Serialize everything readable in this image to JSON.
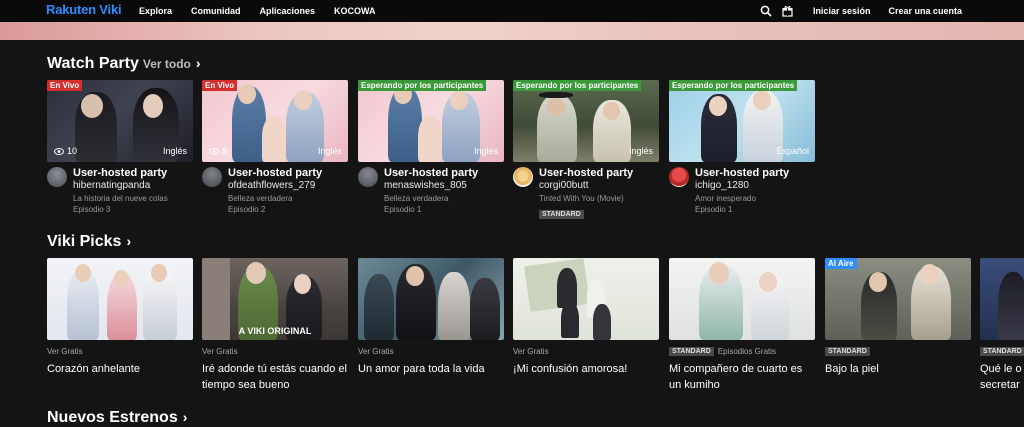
{
  "nav": {
    "logo": "Rakuten Viki",
    "links": [
      "Explora",
      "Comunidad",
      "Aplicaciones",
      "KOCOWA"
    ],
    "sign_in": "Iniciar sesión",
    "create_account": "Crear una cuenta"
  },
  "watch_party": {
    "title": "Watch Party",
    "see_all": "Ver todo",
    "cards": [
      {
        "badge": "En Vivo",
        "viewers": "10",
        "language": "Inglés",
        "title": "User-hosted party",
        "user": "hibernatingpanda",
        "show": "La historia del nueve colas",
        "episode": "Episodio 3"
      },
      {
        "badge": "En Vivo",
        "viewers": "8",
        "language": "Inglés",
        "title": "User-hosted party",
        "user": "ofdeathflowers_279",
        "show": "Belleza verdadera",
        "episode": "Episodio 2"
      },
      {
        "badge": "Esperando por los participantes",
        "language": "Inglés",
        "title": "User-hosted party",
        "user": "menaswishes_805",
        "show": "Belleza verdadera",
        "episode": "Episodio 1"
      },
      {
        "badge": "Esperando por los participantes",
        "language": "Inglés",
        "title": "User-hosted party",
        "user": "corgi00butt",
        "show": "Tinted With You (Movie)",
        "tag": "STANDARD"
      },
      {
        "badge": "Esperando por los participantes",
        "language": "Español",
        "title": "User-hosted party",
        "user": "ichigo_1280",
        "show": "Amor inesperado",
        "episode": "Episodio 1"
      }
    ]
  },
  "viki_picks": {
    "title": "Viki Picks",
    "cards": [
      {
        "sub": "Ver Gratis",
        "title": "Corazón anhelante"
      },
      {
        "sub": "Ver Gratis",
        "title": "Iré adonde tú estás cuando el tiempo sea bueno",
        "overlay": "A VIKI ORIGINAL"
      },
      {
        "sub": "Ver Gratis",
        "title": "Un amor para toda la vida"
      },
      {
        "sub": "Ver Gratis",
        "title": "¡Mi confusión amorosa!"
      },
      {
        "tag": "STANDARD",
        "sub": "Episodios Gratis",
        "title": "Mi compañero de cuarto es un kumiho"
      },
      {
        "badge": "Al Aire",
        "tag": "STANDARD",
        "title": "Bajo la piel"
      },
      {
        "tag": "STANDARD",
        "title": "Qué le o secretar"
      }
    ]
  },
  "new_releases": {
    "title": "Nuevos Estrenos"
  },
  "colors": {
    "brand": "#2d8cff",
    "live": "#d62d2d",
    "waiting": "#3a9a3a",
    "background": "#141414"
  }
}
